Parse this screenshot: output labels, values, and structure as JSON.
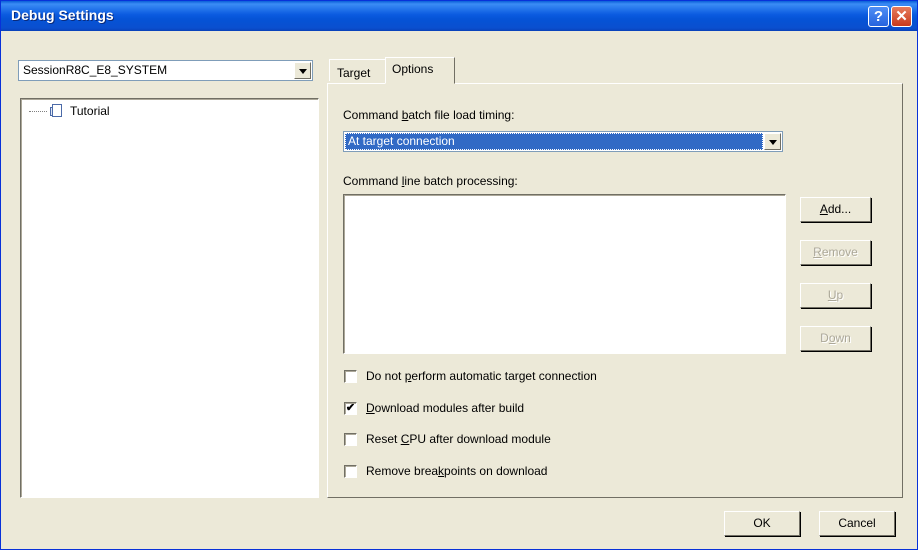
{
  "window": {
    "title": "Debug Settings",
    "help_glyph": "?",
    "close_glyph": "✕"
  },
  "session": {
    "selected": "SessionR8C_E8_SYSTEM"
  },
  "tree": {
    "items": [
      {
        "label": "Tutorial",
        "icon": "session-icon"
      }
    ]
  },
  "tabs": [
    {
      "label": "Target",
      "active": false
    },
    {
      "label": "Options",
      "active": true
    }
  ],
  "options": {
    "timing_label_pre": "Command ",
    "timing_label_key": "b",
    "timing_label_post": "atch file load timing:",
    "timing_value": "At target connection",
    "batch_label_pre": "Command ",
    "batch_label_key": "l",
    "batch_label_post": "ine batch processing:",
    "batch_items": [],
    "buttons": {
      "add": {
        "key": "A",
        "rest": "dd...",
        "enabled": true
      },
      "remove": {
        "key": "R",
        "rest": "emove",
        "enabled": false
      },
      "up": {
        "key": "U",
        "rest": "p",
        "enabled": false
      },
      "down": {
        "pre": "D",
        "key": "o",
        "rest": "wn",
        "enabled": false
      }
    },
    "checkboxes": [
      {
        "pre": "Do not ",
        "key": "p",
        "post": "erform automatic target connection",
        "checked": false
      },
      {
        "pre": "",
        "key": "D",
        "post": "ownload modules after build",
        "checked": true
      },
      {
        "pre": "Reset ",
        "key": "C",
        "post": "PU after download module",
        "checked": false
      },
      {
        "pre": "Remove brea",
        "key": "k",
        "post": "points on download",
        "checked": false
      }
    ],
    "check_glyph": "✔"
  },
  "footer": {
    "ok": "OK",
    "cancel": "Cancel"
  },
  "colors": {
    "title_bar": "#0a58d8",
    "selection": "#316ac5",
    "face": "#ece9d8"
  }
}
